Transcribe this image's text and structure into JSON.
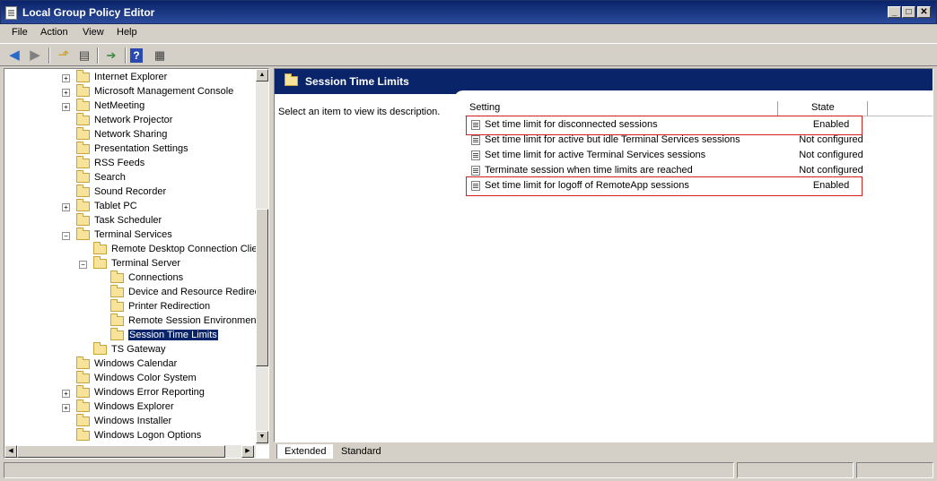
{
  "window": {
    "title": "Local Group Policy Editor"
  },
  "menu": [
    "File",
    "Action",
    "View",
    "Help"
  ],
  "toolbar": {
    "icons": [
      "back-icon",
      "forward-icon",
      "up-folder-icon",
      "show-hide-tree-icon",
      "export-list-icon",
      "help-icon",
      "properties-icon"
    ]
  },
  "tree": {
    "items": [
      {
        "label": "Internet Explorer",
        "expand": "+"
      },
      {
        "label": "Microsoft Management Console",
        "expand": "+"
      },
      {
        "label": "NetMeeting",
        "expand": "+"
      },
      {
        "label": "Network Projector",
        "expand": ""
      },
      {
        "label": "Network Sharing",
        "expand": ""
      },
      {
        "label": "Presentation Settings",
        "expand": ""
      },
      {
        "label": "RSS Feeds",
        "expand": ""
      },
      {
        "label": "Search",
        "expand": ""
      },
      {
        "label": "Sound Recorder",
        "expand": ""
      },
      {
        "label": "Tablet PC",
        "expand": "+"
      },
      {
        "label": "Task Scheduler",
        "expand": ""
      },
      {
        "label": "Terminal Services",
        "expand": "−"
      },
      {
        "label": "Remote Desktop Connection Clier",
        "expand": ""
      },
      {
        "label": "Terminal Server",
        "expand": "−"
      },
      {
        "label": "Connections",
        "expand": ""
      },
      {
        "label": "Device and Resource Redirec",
        "expand": ""
      },
      {
        "label": "Printer Redirection",
        "expand": ""
      },
      {
        "label": "Remote Session Environment",
        "expand": ""
      },
      {
        "label": "Session Time Limits",
        "expand": "",
        "selected": true
      },
      {
        "label": "TS Gateway",
        "expand": ""
      },
      {
        "label": "Windows Calendar",
        "expand": ""
      },
      {
        "label": "Windows Color System",
        "expand": ""
      },
      {
        "label": "Windows Error Reporting",
        "expand": "+"
      },
      {
        "label": "Windows Explorer",
        "expand": "+"
      },
      {
        "label": "Windows Installer",
        "expand": ""
      },
      {
        "label": "Windows Logon Options",
        "expand": ""
      }
    ]
  },
  "details": {
    "title": "Session Time Limits",
    "description": "Select an item to view its description.",
    "columns": {
      "setting": "Setting",
      "state": "State"
    },
    "rows": [
      {
        "setting": "Set time limit for disconnected sessions",
        "state": "Enabled",
        "highlighted": true
      },
      {
        "setting": "Set time limit for active but idle Terminal Services sessions",
        "state": "Not configured"
      },
      {
        "setting": "Set time limit for active Terminal Services sessions",
        "state": "Not configured"
      },
      {
        "setting": "Terminate session when time limits are reached",
        "state": "Not configured"
      },
      {
        "setting": "Set time limit for logoff of RemoteApp sessions",
        "state": "Enabled",
        "highlighted": true
      }
    ]
  },
  "tabs": [
    "Extended",
    "Standard"
  ],
  "colors": {
    "title_bar": "#0a246a",
    "highlight_border": "#d02020",
    "folder": "#f7e39a"
  }
}
